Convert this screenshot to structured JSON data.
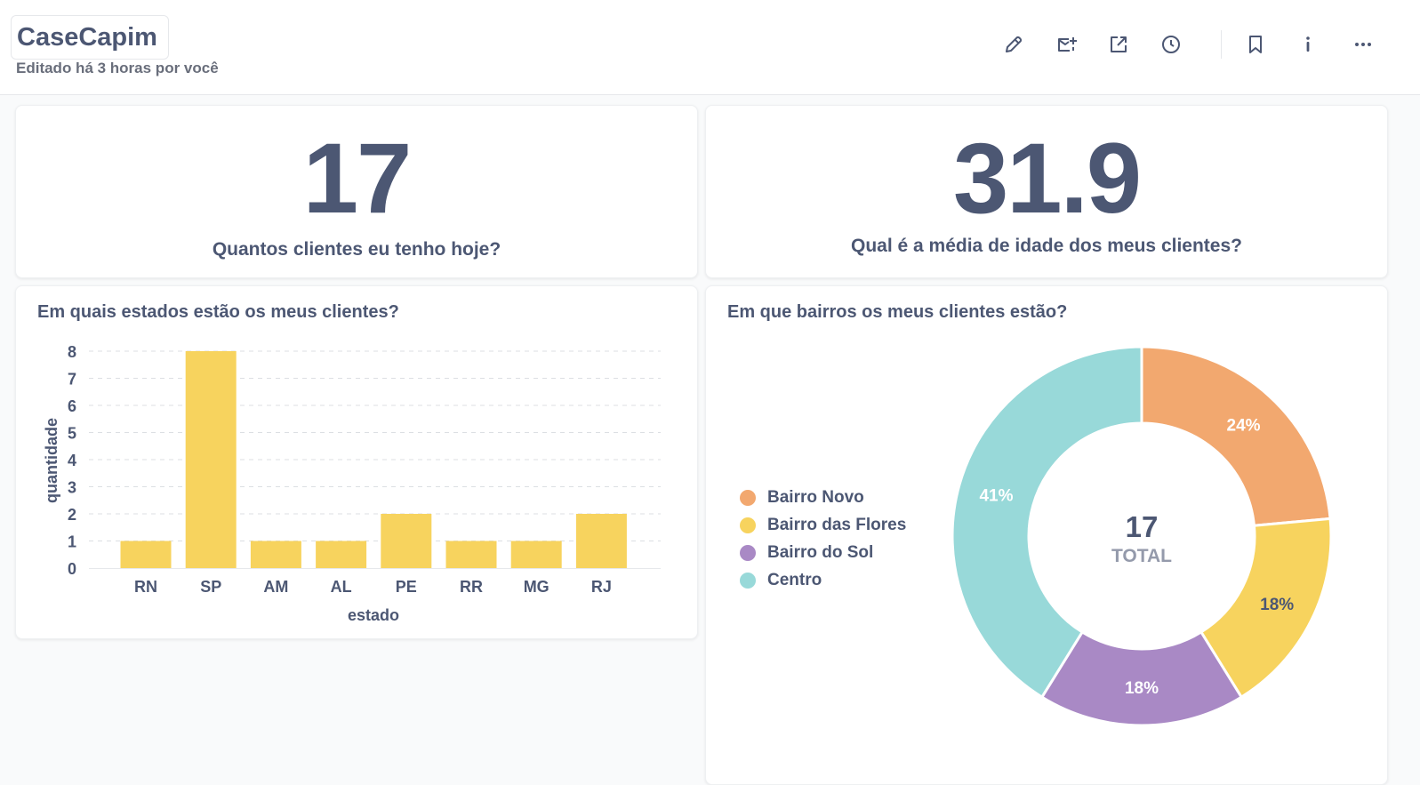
{
  "dashboard": {
    "title": "CaseCapim",
    "subtitle": "Editado há 3 horas por você"
  },
  "toolbar": {
    "icons": [
      "pencil-icon",
      "subscription-icon",
      "share-icon",
      "history-icon",
      "bookmark-icon",
      "info-icon",
      "more-icon"
    ]
  },
  "cards": {
    "clients_count": {
      "value": "17",
      "label": "Quantos clientes eu tenho hoje?"
    },
    "avg_age": {
      "value": "31.9",
      "label": "Qual é a média de idade dos meus clientes?"
    },
    "states_chart": {
      "title": "Em quais estados estão os meus clientes?"
    },
    "neighborhoods_chart": {
      "title": "Em que bairros os meus clientes estão?",
      "center_value": "17",
      "center_label": "TOTAL"
    }
  },
  "colors": {
    "text": "#4c5773",
    "bar": "#f7d35e",
    "pie": [
      "#f2a86f",
      "#f7d35e",
      "#a989c5",
      "#98d9d9"
    ]
  },
  "chart_data": [
    {
      "type": "bar",
      "title": "Em quais estados estão os meus clientes?",
      "categories": [
        "RN",
        "SP",
        "AM",
        "AL",
        "PE",
        "RR",
        "MG",
        "RJ"
      ],
      "values": [
        1,
        8,
        1,
        1,
        2,
        1,
        1,
        2
      ],
      "xlabel": "estado",
      "ylabel": "quantidade",
      "ylim": [
        0,
        8
      ],
      "yticks": [
        "0",
        "1",
        "2",
        "3",
        "4",
        "5",
        "6",
        "7",
        "8"
      ],
      "grid": true
    },
    {
      "type": "pie",
      "title": "Em que bairros os meus clientes estão?",
      "labels": [
        "Bairro Novo",
        "Bairro das Flores",
        "Bairro do Sol",
        "Centro"
      ],
      "values": [
        4,
        3,
        3,
        7
      ],
      "percent_labels": [
        "24%",
        "18%",
        "18%",
        "41%"
      ],
      "total": 17,
      "legend": "left"
    }
  ]
}
